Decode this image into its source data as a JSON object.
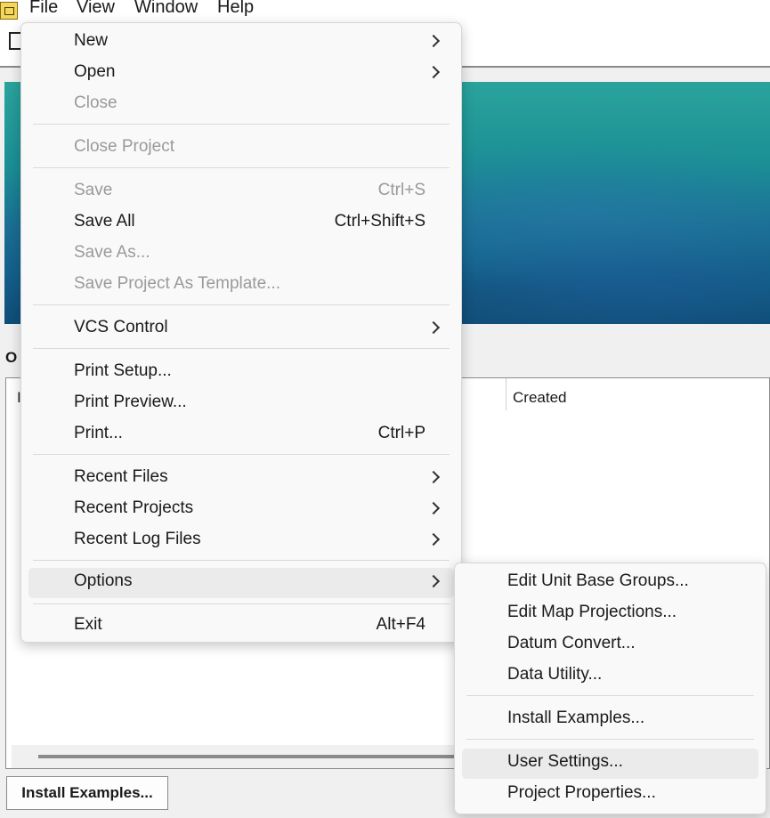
{
  "menubar": {
    "items": [
      "File",
      "View",
      "Window",
      "Help"
    ]
  },
  "main": {
    "section_label": "O",
    "list": {
      "first_column_fragment": "I",
      "created_header": "Created"
    },
    "install_button": "Install Examples..."
  },
  "file_menu": {
    "items": [
      {
        "label": "New",
        "submenu": true
      },
      {
        "label": "Open",
        "submenu": true
      },
      {
        "label": "Close",
        "disabled": true
      },
      {
        "label": "Close Project",
        "disabled": true
      },
      {
        "label": "Save",
        "shortcut": "Ctrl+S",
        "disabled": true
      },
      {
        "label": "Save All",
        "shortcut": "Ctrl+Shift+S"
      },
      {
        "label": "Save As...",
        "disabled": true
      },
      {
        "label": "Save Project As Template...",
        "disabled": true
      },
      {
        "label": "VCS Control",
        "submenu": true
      },
      {
        "label": "Print Setup..."
      },
      {
        "label": "Print Preview..."
      },
      {
        "label": "Print...",
        "shortcut": "Ctrl+P"
      },
      {
        "label": "Recent Files",
        "submenu": true
      },
      {
        "label": "Recent Projects",
        "submenu": true
      },
      {
        "label": "Recent Log Files",
        "submenu": true
      },
      {
        "label": "Options",
        "submenu": true,
        "highlighted": true
      },
      {
        "label": "Exit",
        "shortcut": "Alt+F4"
      }
    ]
  },
  "options_submenu": {
    "items": [
      {
        "label": "Edit Unit Base Groups..."
      },
      {
        "label": "Edit Map Projections..."
      },
      {
        "label": "Datum Convert..."
      },
      {
        "label": "Data Utility..."
      },
      {
        "label": "Install Examples..."
      },
      {
        "label": "User Settings...",
        "highlighted": true
      },
      {
        "label": "Project Properties..."
      }
    ]
  }
}
